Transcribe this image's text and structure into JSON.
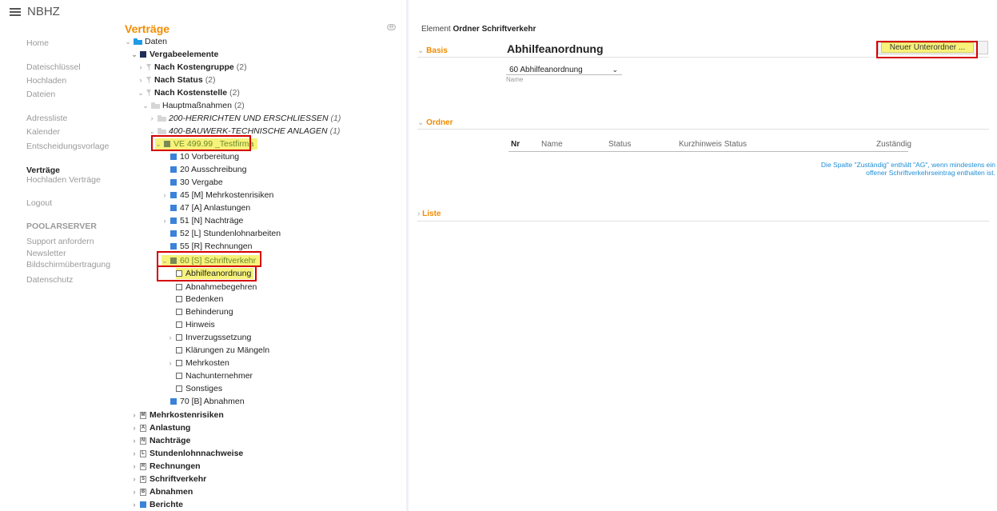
{
  "app": {
    "title": "NBHZ"
  },
  "nav": {
    "items": [
      {
        "label": "Home"
      },
      {
        "label": "Dateischlüssel"
      },
      {
        "label": "Hochladen"
      },
      {
        "label": "Dateien"
      },
      {
        "label": "Adressliste"
      },
      {
        "label": "Kalender"
      },
      {
        "label": "Entscheidungsvorlage"
      },
      {
        "label": "Verträge"
      },
      {
        "label": "Hochladen Verträge"
      },
      {
        "label": "Logout"
      },
      {
        "label": "POOLARSERVER"
      },
      {
        "label": "Support anfordern"
      },
      {
        "label": "Newsletter"
      },
      {
        "label": "Bildschirmübertragung"
      },
      {
        "label": "Datenschutz"
      }
    ],
    "active": "Verträge"
  },
  "tree": {
    "heading": "Verträge",
    "nodes": [
      {
        "label": "Daten",
        "count": ""
      },
      {
        "label": "Vergabeelemente",
        "count": ""
      },
      {
        "label": "Nach Kostengruppe",
        "count": "(2)"
      },
      {
        "label": "Nach Status",
        "count": "(2)"
      },
      {
        "label": "Nach Kostenstelle",
        "count": "(2)"
      },
      {
        "label": "Hauptmaßnahmen",
        "count": "(2)"
      },
      {
        "label": "200-HERRICHTEN UND ERSCHLIESSEN",
        "count": "(1)"
      },
      {
        "label": "400-BAUWERK-TECHNISCHE ANLAGEN",
        "count": "(1)"
      },
      {
        "label": "VE 499.99 _Testfirma",
        "count": ""
      },
      {
        "label": "10 Vorbereitung",
        "count": ""
      },
      {
        "label": "20 Ausschreibung",
        "count": ""
      },
      {
        "label": "30 Vergabe",
        "count": ""
      },
      {
        "label": "45 [M] Mehrkostenrisiken",
        "count": ""
      },
      {
        "label": "47 [A] Anlastungen",
        "count": ""
      },
      {
        "label": "51 [N] Nachträge",
        "count": ""
      },
      {
        "label": "52 [L] Stundenlohnarbeiten",
        "count": ""
      },
      {
        "label": "55 [R] Rechnungen",
        "count": ""
      },
      {
        "label": "60 [S] Schriftverkehr",
        "count": ""
      },
      {
        "label": "Abhilfeanordnung",
        "count": ""
      },
      {
        "label": "Abnahmebegehren",
        "count": ""
      },
      {
        "label": "Bedenken",
        "count": ""
      },
      {
        "label": "Behinderung",
        "count": ""
      },
      {
        "label": "Hinweis",
        "count": ""
      },
      {
        "label": "Inverzugssetzung",
        "count": ""
      },
      {
        "label": "Klärungen zu Mängeln",
        "count": ""
      },
      {
        "label": "Mehrkosten",
        "count": ""
      },
      {
        "label": "Nachunternehmer",
        "count": ""
      },
      {
        "label": "Sonstiges",
        "count": ""
      },
      {
        "label": "70 [B] Abnahmen",
        "count": ""
      },
      {
        "label": "Mehrkostenrisiken",
        "letter": "M"
      },
      {
        "label": "Anlastung",
        "letter": "A"
      },
      {
        "label": "Nachträge",
        "letter": "N"
      },
      {
        "label": "Stundenlohnnachweise",
        "letter": "L"
      },
      {
        "label": "Rechnungen",
        "letter": "R"
      },
      {
        "label": "Schriftverkehr",
        "letter": "S"
      },
      {
        "label": "Abnahmen",
        "letter": "B"
      },
      {
        "label": "Berichte",
        "letter": ""
      }
    ]
  },
  "detail": {
    "breadcrumb_prefix": "Element",
    "breadcrumb_value": "Ordner Schriftverkehr",
    "sections": {
      "basis": "Basis",
      "ordner": "Ordner",
      "liste": "Liste"
    },
    "folder_title": "Abhilfeanordnung",
    "new_subfolder_label": "Neuer Unterordner ...",
    "name_select_value": "60 Abhilfeanordnung",
    "name_field_hint": "Name",
    "table_headers": [
      "Nr",
      "Name",
      "Status",
      "Kurzhinweis Status",
      "Zuständig"
    ],
    "note": "Die Spalte \"Zuständig\" enthält \"AG\", wenn mindestens ein offener Schriftverkehrseintrag enthalten ist."
  },
  "colors": {
    "accent": "#f28c00",
    "highlight": "#f6f27a",
    "annotation": "#d50000",
    "link": "#1f8fd6",
    "tree_blue": "#3a83d8"
  }
}
